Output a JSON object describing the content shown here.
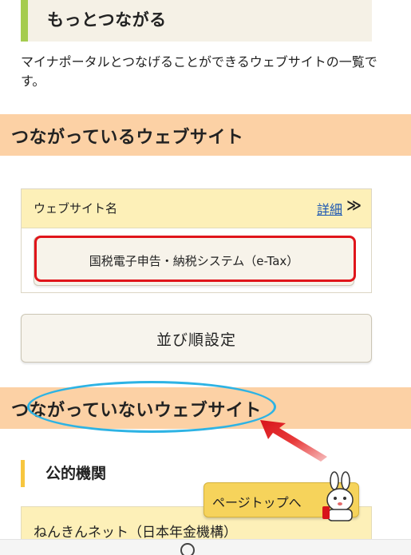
{
  "header": {
    "title": "もっとつながる"
  },
  "intro": {
    "text": "マイナポータルとつなげることができるウェブサイトの一覧です。"
  },
  "connected_section": {
    "title": "つながっているウェブサイト",
    "table_header": "ウェブサイト名",
    "detail_link": "詳細",
    "detail_chevron": "≫",
    "sites": [
      "国税電子申告・納税システム（e-Tax）"
    ]
  },
  "sort_button": {
    "label": "並び順設定"
  },
  "unconnected_section": {
    "title": "つながっていないウェブサイト",
    "subheading": "公的機関",
    "first_site": "ねんきんネット（日本年金機構）"
  },
  "page_top": {
    "label": "ページトップへ"
  },
  "colors": {
    "section_bar": "#fcd1a5",
    "table_header": "#fdf0b8",
    "accent_green": "#a5cc4f",
    "accent_yellow": "#f7c63f",
    "highlight_red": "#e0151b",
    "highlight_blue": "#2db3e4",
    "link": "#1a56b3"
  },
  "icons": [
    "chevron-double-right-icon",
    "red-arrow-annotation",
    "mascot-icon",
    "home-circle-icon"
  ]
}
